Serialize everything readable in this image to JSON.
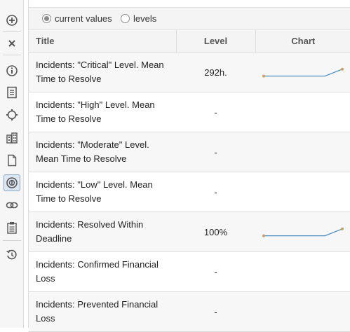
{
  "toolbar": {
    "buttons": [
      {
        "icon": "add-circle-icon"
      },
      {
        "icon": "close-icon"
      },
      {
        "icon": "info-icon"
      },
      {
        "icon": "list-document-icon"
      },
      {
        "icon": "refresh-icon"
      },
      {
        "icon": "buildings-icon"
      },
      {
        "icon": "blank-page-icon"
      },
      {
        "icon": "indicator-icon",
        "active": true
      },
      {
        "icon": "link-icon"
      },
      {
        "icon": "clipboard-icon"
      },
      {
        "icon": "history-icon"
      }
    ]
  },
  "view_mode": {
    "options": [
      {
        "label": "current values",
        "selected": true
      },
      {
        "label": "levels",
        "selected": false
      }
    ]
  },
  "table": {
    "headers": {
      "title": "Title",
      "level": "Level",
      "chart": "Chart"
    },
    "rows": [
      {
        "title": "Incidents: \"Critical\" Level. Mean Time to Resolve",
        "level": "292h.",
        "has_chart": true,
        "trend": [
          0.1,
          0.1,
          0.1,
          0.8
        ]
      },
      {
        "title": "Incidents: \"High\" Level. Mean Time to Resolve",
        "level": "-",
        "has_chart": false
      },
      {
        "title": "Incidents: \"Moderate\" Level. Mean Time to Resolve",
        "level": "-",
        "has_chart": false
      },
      {
        "title": "Incidents: \"Low\" Level. Mean Time to Resolve",
        "level": "-",
        "has_chart": false
      },
      {
        "title": "Incidents: Resolved Within Deadline",
        "level": "100%",
        "has_chart": true,
        "trend": [
          0.1,
          0.1,
          0.1,
          0.8
        ]
      },
      {
        "title": "Incidents: Confirmed Financial Loss",
        "level": "-",
        "has_chart": false
      },
      {
        "title": "Incidents: Prevented Financial Loss",
        "level": "-",
        "has_chart": false
      }
    ]
  },
  "colors": {
    "spark_line": "#4a8fbf",
    "spark_point": "#c9a06a",
    "accent": "#8aa6c4"
  }
}
